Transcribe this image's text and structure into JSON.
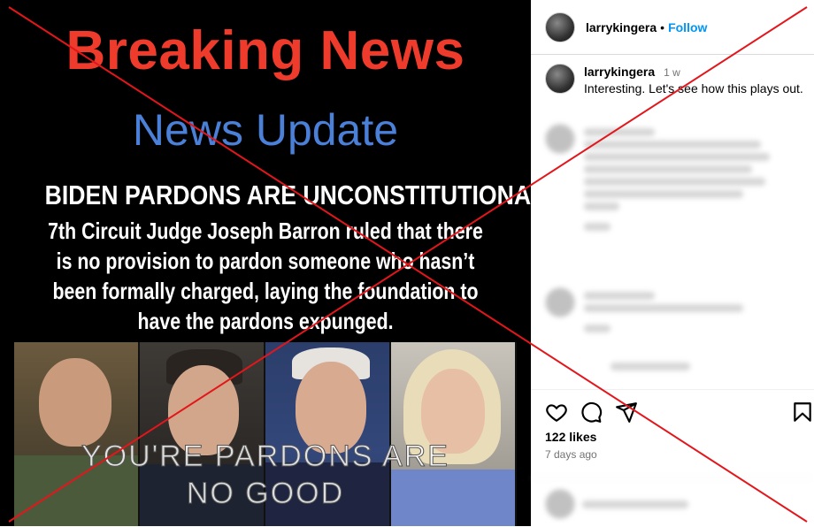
{
  "post_image": {
    "breaking": "Breaking News",
    "update": "News Update",
    "headline": "BIDEN PARDONS ARE UNCONSTITUTIONAL!",
    "body_lines": [
      "7th Circuit Judge Joseph Barron ruled that there",
      "is no provision to pardon someone who hasn’t",
      "been formally charged, laying the foundation to",
      "have the pardons expunged."
    ],
    "caption_lines": [
      "YOU'RE PARDONS ARE",
      "NO GOOD"
    ]
  },
  "header": {
    "username": "larrykingera",
    "separator": "•",
    "follow_label": "Follow"
  },
  "caption": {
    "username": "larrykingera",
    "time": "1 w",
    "text": "Interesting. Let's see how this plays out."
  },
  "actions": {
    "like_icon": "heart-icon",
    "comment_icon": "comment-icon",
    "share_icon": "share-icon",
    "save_icon": "bookmark-icon"
  },
  "stats": {
    "likes": "122 likes",
    "posted": "7 days ago"
  },
  "colors": {
    "breaking_red": "#ee3b2c",
    "update_blue": "#4a80d8",
    "follow_blue": "#0095f6",
    "cross_red": "#e3161b"
  }
}
